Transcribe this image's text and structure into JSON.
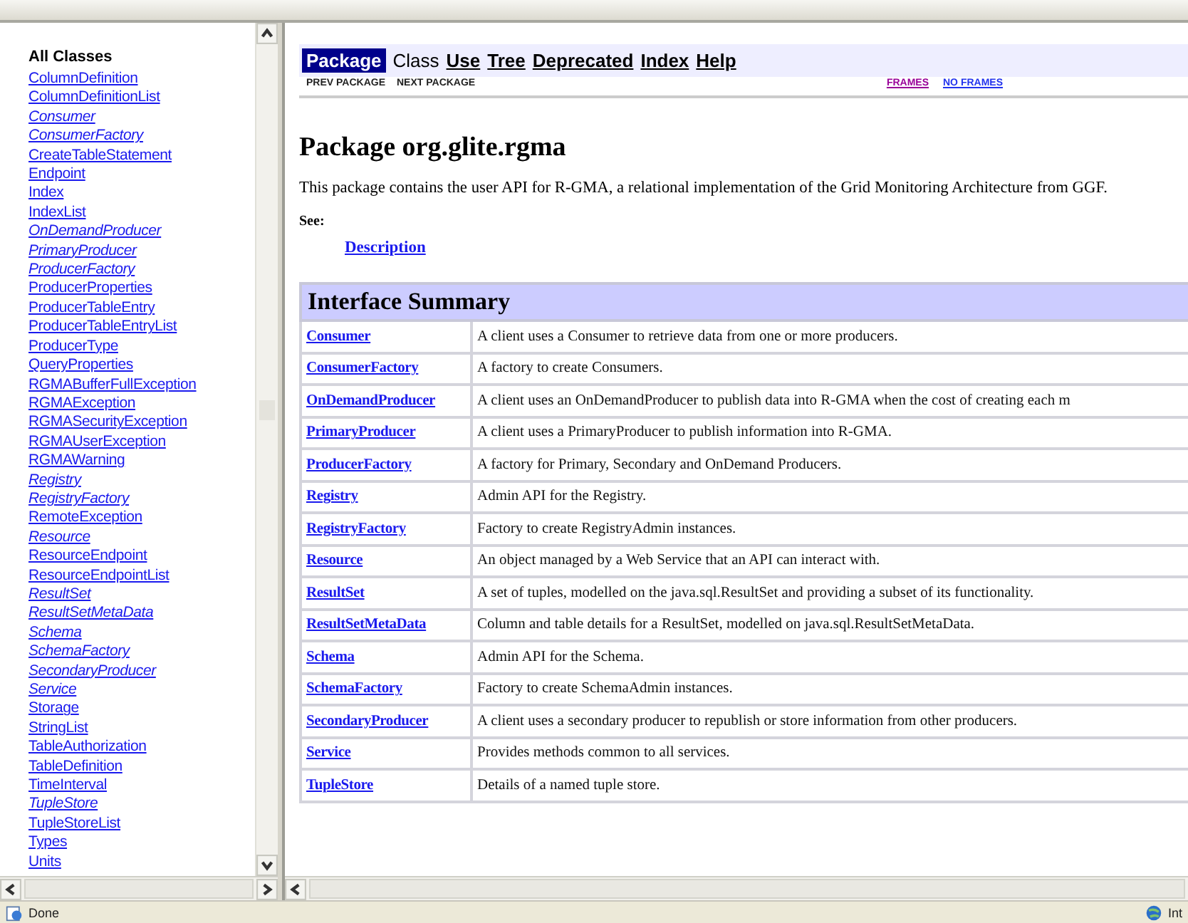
{
  "sidebar": {
    "title": "All Classes",
    "items": [
      {
        "label": "ColumnDefinition",
        "kind": "class"
      },
      {
        "label": "ColumnDefinitionList",
        "kind": "class"
      },
      {
        "label": "Consumer",
        "kind": "interface"
      },
      {
        "label": "ConsumerFactory",
        "kind": "interface"
      },
      {
        "label": "CreateTableStatement",
        "kind": "class"
      },
      {
        "label": "Endpoint",
        "kind": "class"
      },
      {
        "label": "Index",
        "kind": "class"
      },
      {
        "label": "IndexList",
        "kind": "class"
      },
      {
        "label": "OnDemandProducer",
        "kind": "interface"
      },
      {
        "label": "PrimaryProducer",
        "kind": "interface"
      },
      {
        "label": "ProducerFactory",
        "kind": "interface"
      },
      {
        "label": "ProducerProperties",
        "kind": "class"
      },
      {
        "label": "ProducerTableEntry",
        "kind": "class"
      },
      {
        "label": "ProducerTableEntryList",
        "kind": "class"
      },
      {
        "label": "ProducerType",
        "kind": "class"
      },
      {
        "label": "QueryProperties",
        "kind": "class"
      },
      {
        "label": "RGMABufferFullException",
        "kind": "class"
      },
      {
        "label": "RGMAException",
        "kind": "class"
      },
      {
        "label": "RGMASecurityException",
        "kind": "class"
      },
      {
        "label": "RGMAUserException",
        "kind": "class"
      },
      {
        "label": "RGMAWarning",
        "kind": "class"
      },
      {
        "label": "Registry",
        "kind": "interface"
      },
      {
        "label": "RegistryFactory",
        "kind": "interface"
      },
      {
        "label": "RemoteException",
        "kind": "class"
      },
      {
        "label": "Resource",
        "kind": "interface"
      },
      {
        "label": "ResourceEndpoint",
        "kind": "class"
      },
      {
        "label": "ResourceEndpointList",
        "kind": "class"
      },
      {
        "label": "ResultSet",
        "kind": "interface"
      },
      {
        "label": "ResultSetMetaData",
        "kind": "interface"
      },
      {
        "label": "Schema",
        "kind": "interface"
      },
      {
        "label": "SchemaFactory",
        "kind": "interface"
      },
      {
        "label": "SecondaryProducer",
        "kind": "interface"
      },
      {
        "label": "Service",
        "kind": "interface"
      },
      {
        "label": "Storage",
        "kind": "class"
      },
      {
        "label": "StringList",
        "kind": "class"
      },
      {
        "label": "TableAuthorization",
        "kind": "class"
      },
      {
        "label": "TableDefinition",
        "kind": "class"
      },
      {
        "label": "TimeInterval",
        "kind": "class"
      },
      {
        "label": "TupleStore",
        "kind": "interface"
      },
      {
        "label": "TupleStoreList",
        "kind": "class"
      },
      {
        "label": "Types",
        "kind": "class"
      },
      {
        "label": "Units",
        "kind": "class"
      }
    ]
  },
  "navbar": {
    "tabs": [
      {
        "label": "Package",
        "selected": true,
        "disabled": false
      },
      {
        "label": "Class",
        "selected": false,
        "disabled": true
      },
      {
        "label": "Use",
        "selected": false,
        "disabled": false
      },
      {
        "label": "Tree",
        "selected": false,
        "disabled": false
      },
      {
        "label": "Deprecated",
        "selected": false,
        "disabled": false
      },
      {
        "label": "Index",
        "selected": false,
        "disabled": false
      },
      {
        "label": "Help",
        "selected": false,
        "disabled": false
      }
    ],
    "subnav": [
      "PREV PACKAGE",
      "NEXT PACKAGE"
    ],
    "frame_links": [
      {
        "label": "FRAMES",
        "visited": true
      },
      {
        "label": "NO FRAMES",
        "visited": false
      }
    ]
  },
  "heading": "Package org.glite.rgma",
  "intro": "This package contains the user API for R-GMA, a relational implementation of the Grid Monitoring Architecture from GGF.",
  "see": {
    "label": "See:",
    "link": "Description"
  },
  "table": {
    "title": "Interface Summary",
    "rows": [
      {
        "name": "Consumer",
        "description": "A client uses a Consumer to retrieve data from one or more producers."
      },
      {
        "name": "ConsumerFactory",
        "description": "A factory to create Consumers."
      },
      {
        "name": "OnDemandProducer",
        "description": "A client uses an OnDemandProducer to publish data into R-GMA when the cost of creating each m"
      },
      {
        "name": "PrimaryProducer",
        "description": "A client uses a PrimaryProducer to publish information into R-GMA."
      },
      {
        "name": "ProducerFactory",
        "description": "A factory for Primary, Secondary and OnDemand Producers."
      },
      {
        "name": "Registry",
        "description": "Admin API for the Registry."
      },
      {
        "name": "RegistryFactory",
        "description": "Factory to create RegistryAdmin instances."
      },
      {
        "name": "Resource",
        "description": "An object managed by a Web Service that an API can interact with."
      },
      {
        "name": "ResultSet",
        "description": "A set of tuples, modelled on the java.sql.ResultSet and providing a subset of its functionality."
      },
      {
        "name": "ResultSetMetaData",
        "description": "Column and table details for a ResultSet, modelled on java.sql.ResultSetMetaData."
      },
      {
        "name": "Schema",
        "description": "Admin API for the Schema."
      },
      {
        "name": "SchemaFactory",
        "description": "Factory to create SchemaAdmin instances."
      },
      {
        "name": "SecondaryProducer",
        "description": "A client uses a secondary producer to republish or store information from other producers."
      },
      {
        "name": "Service",
        "description": "Provides methods common to all services."
      },
      {
        "name": "TupleStore",
        "description": "Details of a named tuple store."
      }
    ]
  },
  "status_bar": {
    "text": "Done",
    "zone": "Int"
  }
}
